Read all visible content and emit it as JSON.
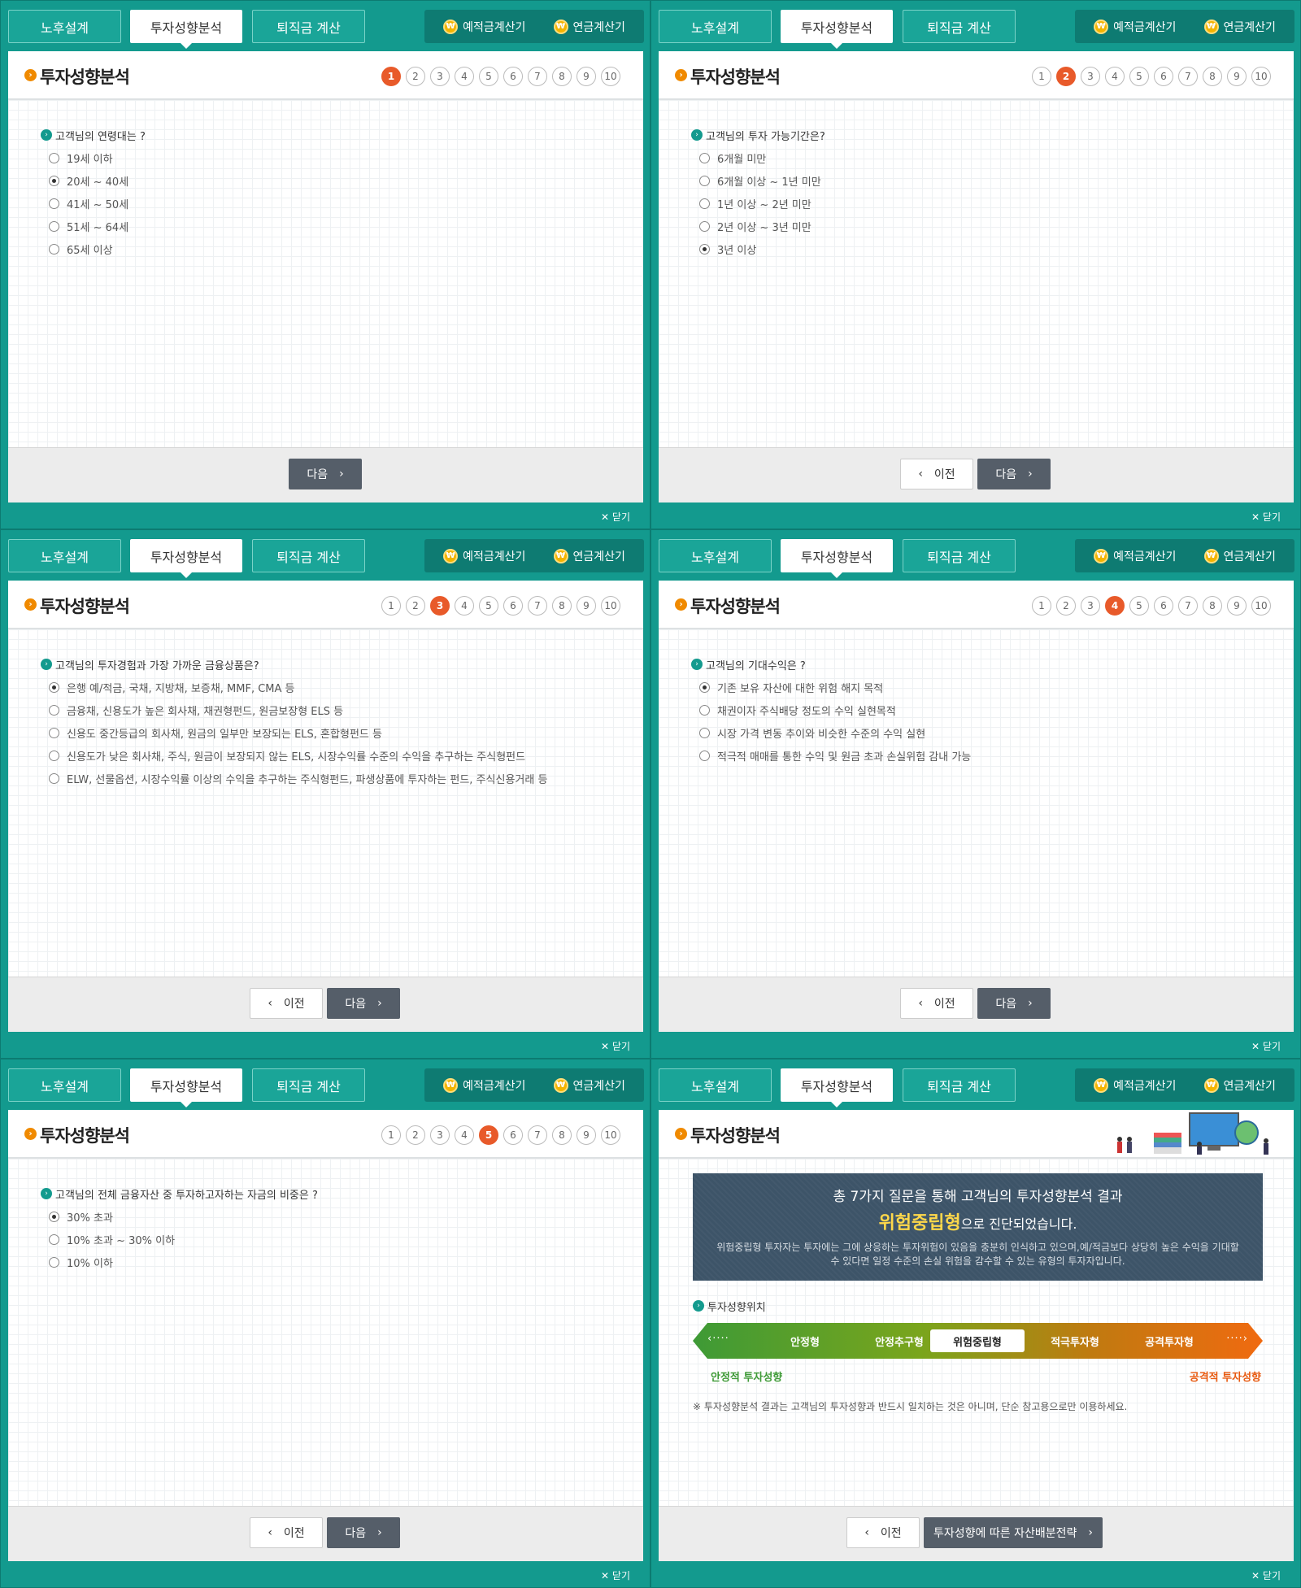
{
  "tabs": [
    "노후설계",
    "투자성향분석",
    "퇴직금 계산"
  ],
  "calcs": [
    "예적금계산기",
    "연금계산기"
  ],
  "coin": "₩",
  "title": "투자성향분석",
  "steps": [
    "1",
    "2",
    "3",
    "4",
    "5",
    "6",
    "7",
    "8",
    "9",
    "10"
  ],
  "btn": {
    "next": "다음",
    "prev": "이전",
    "strategy": "투자성향에 따른 자산배분전략",
    "arrow_next": "›",
    "arrow_prev": "‹"
  },
  "close": "✕ 닫기",
  "panels": [
    {
      "current_step": 1,
      "question": "고객님의 연령대는 ?",
      "selected": 1,
      "options": [
        "19세 이하",
        "20세 ~ 40세",
        "41세 ~ 50세",
        "51세 ~ 64세",
        "65세 이상"
      ]
    },
    {
      "current_step": 2,
      "question": "고객님의 투자 가능기간은?",
      "selected": 4,
      "options": [
        "6개월 미만",
        "6개월 이상 ~ 1년 미만",
        "1년 이상 ~ 2년 미만",
        "2년 이상 ~ 3년 미만",
        "3년 이상"
      ]
    },
    {
      "current_step": 3,
      "question": "고객님의 투자경험과 가장 가까운 금융상품은?",
      "selected": 0,
      "options": [
        "은행 예/적금, 국채, 지방채, 보증채, MMF, CMA 등",
        "금융채, 신용도가 높은 회사채, 채권형펀드, 원금보장형 ELS 등",
        "신용도 중간등급의 회사채, 원금의 일부만 보장되는 ELS, 혼합형펀드 등",
        "신용도가 낮은 회사채, 주식, 원금이 보장되지 않는 ELS, 시장수익률 수준의 수익을 추구하는 주식형펀드",
        "ELW, 선물옵션, 시장수익률 이상의 수익을 추구하는 주식형펀드, 파생상품에 투자하는 펀드, 주식신용거래 등"
      ]
    },
    {
      "current_step": 4,
      "question": "고객님의 기대수익은 ?",
      "selected": 0,
      "options": [
        "기존 보유 자산에 대한 위험 해지 목적",
        "채권이자 주식배당 정도의 수익 실현목적",
        "시장 가격 변동 추이와 비슷한 수준의 수익 실현",
        "적극적 매매를 통한 수익 및 원금 초과 손실위험 감내 가능"
      ]
    },
    {
      "current_step": 5,
      "question": "고객님의 전체 금융자산 중 투자하고자하는 자금의 비중은 ?",
      "selected": 0,
      "options": [
        "30% 초과",
        "10% 초과 ~ 30% 이하",
        "10% 이하"
      ]
    }
  ],
  "result": {
    "line1": "총 7가지 질문을 통해 고객님의 투자성향분석 결과",
    "type": "위험중립형",
    "suffix": "으로 진단되었습니다.",
    "desc": "위험중립형 투자자는 투자에는 그에 상응하는 투자위험이 있음을 충분히 인식하고 있으며,예/적금보다 상당히 높은 수익을 기대할 수 있다면 일정 수준의 손실 위험을 감수할 수 있는 유형의 투자자입니다.",
    "position_title": "투자성향위치",
    "levels": [
      "안정형",
      "안정추구형",
      "위험중립형",
      "적극투자형",
      "공격투자형"
    ],
    "selected_level": 2,
    "left_end": "안정적 투자성향",
    "right_end": "공격적 투자성향",
    "note": "※ 투자성향분석 결과는 고객님의 투자성향과 반드시 일치하는 것은 아니며, 단순 참고용으로만 이용하세요.",
    "end_colors": {
      "left": "#3e9a36",
      "right": "#e85a10"
    }
  },
  "colors": {
    "teal": "#139a8e",
    "accent": "#e85a2a",
    "button": "#555e69"
  }
}
